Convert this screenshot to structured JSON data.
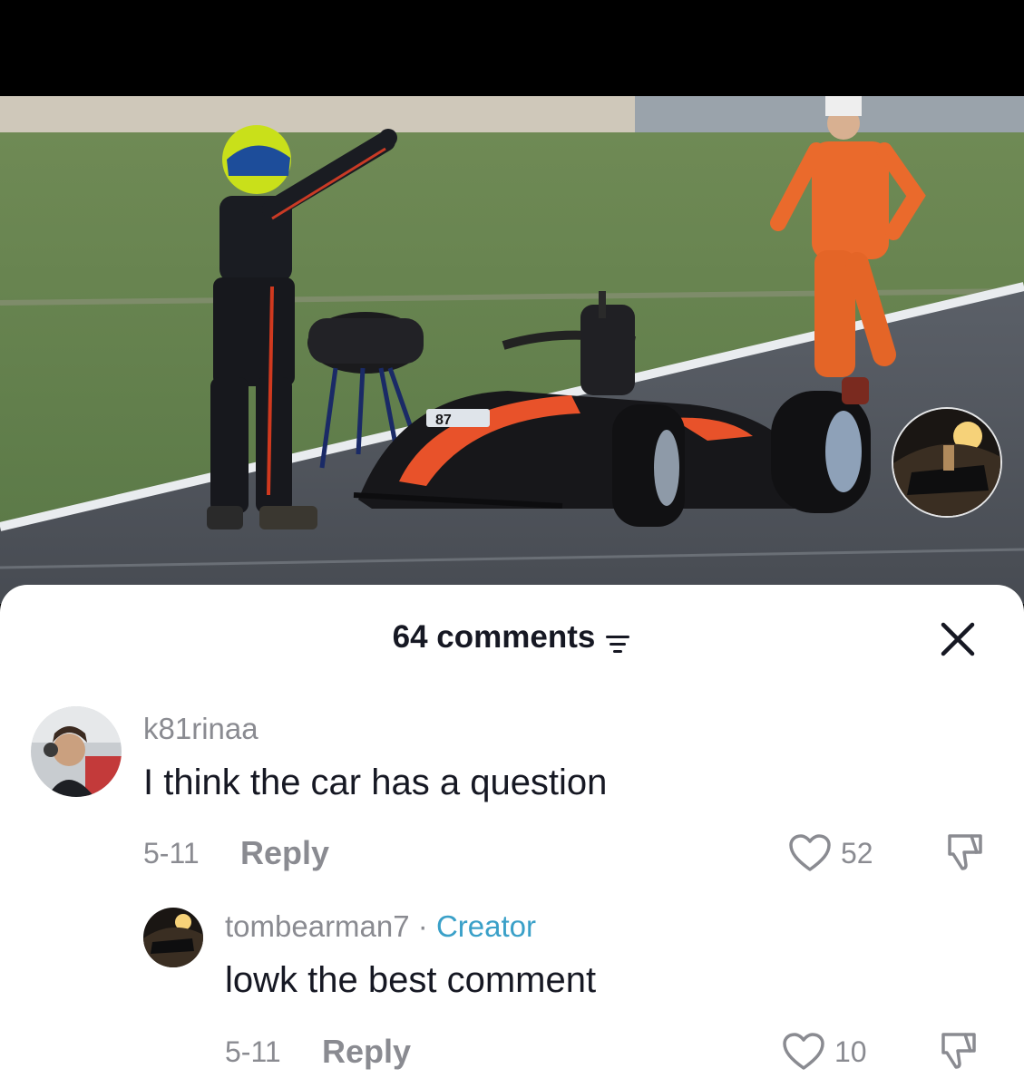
{
  "video": {
    "car_number": "87",
    "scene": "racing-track-driver-and-marshal"
  },
  "comments_panel": {
    "count_label": "64 comments",
    "filter_icon": "filter-icon",
    "close_icon": "close-icon"
  },
  "comments": [
    {
      "username": "k81rinaa",
      "text": "I think the car has a question",
      "date": "5-11",
      "reply_label": "Reply",
      "likes": "52"
    }
  ],
  "replies": [
    {
      "username": "tombearman7",
      "separator": "·",
      "badge": "Creator",
      "text": "lowk the best comment",
      "date": "5-11",
      "reply_label": "Reply",
      "likes": "10"
    }
  ],
  "colors": {
    "accent_creator": "#3aa0c8",
    "text_primary": "#161823",
    "text_secondary": "#8a8b91"
  }
}
